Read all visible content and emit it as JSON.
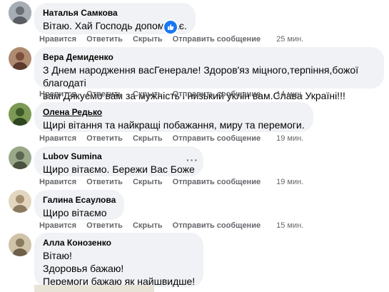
{
  "actions": {
    "like": "Нравится",
    "reply": "Ответить",
    "hide": "Скрыть",
    "send": "Отправить сообщение"
  },
  "comments": [
    {
      "author": "Наталья Самкова",
      "text": "Вітаю. Хай Господь допомагає.",
      "time": "25 мин.",
      "avatar_color": "#8a8f99"
    },
    {
      "author": "Вера Демиденко",
      "text": "З Днем народження васГенерале! Здоров'яз міцного,терпіння,божої благодаті\nвам Дякуємо вам за мужність і низький уклін вам.Слава Україні!!!",
      "time": "14 мин.",
      "avatar_color": "#9b6a55"
    },
    {
      "author": "Олена Редько",
      "text": "Щирі вітання та найкращі побажання, миру та перемоги.",
      "time": "19 мин.",
      "avatar_color": "#5e7a3c"
    },
    {
      "author": "Lubov Sumina",
      "text": "Щиро вітаємо. Бережи Вас Боже",
      "time": "19 мин.",
      "avatar_color": "#7a8a6e"
    },
    {
      "author": "Галина Есаулова",
      "text": "Щиро вітаємо",
      "time": "15 мин.",
      "avatar_color": "#c9b89a"
    },
    {
      "author": "Алла Конозенко",
      "text": "Вітаю!\nЗдоровья бажаю!\nПеремоги бажаю як найшвидше!",
      "time": "",
      "avatar_color": "#b5a58c"
    }
  ]
}
